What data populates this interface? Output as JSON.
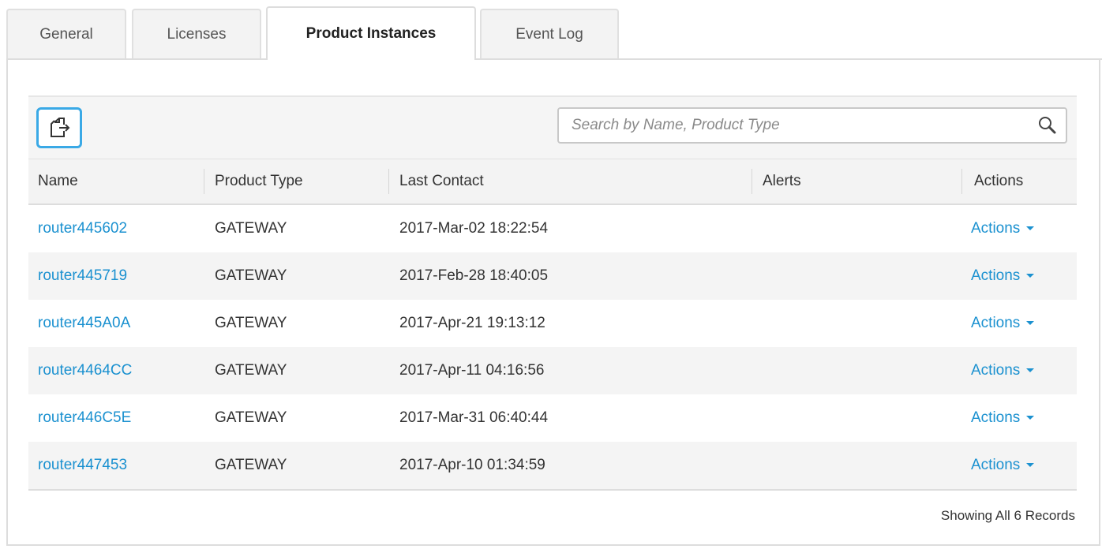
{
  "tabs": [
    {
      "label": "General",
      "active": false
    },
    {
      "label": "Licenses",
      "active": false
    },
    {
      "label": "Product Instances",
      "active": true
    },
    {
      "label": "Event Log",
      "active": false
    }
  ],
  "toolbar": {
    "export_icon": "export-icon",
    "search_placeholder": "Search by Name, Product Type",
    "search_value": "",
    "search_icon": "search-icon"
  },
  "table": {
    "columns": [
      "Name",
      "Product Type",
      "Last Contact",
      "Alerts",
      "Actions"
    ],
    "rows": [
      {
        "name": "router445602",
        "product_type": "GATEWAY",
        "last_contact": "2017-Mar-02 18:22:54",
        "alerts": "",
        "actions": "Actions"
      },
      {
        "name": "router445719",
        "product_type": "GATEWAY",
        "last_contact": "2017-Feb-28 18:40:05",
        "alerts": "",
        "actions": "Actions"
      },
      {
        "name": "router445A0A",
        "product_type": "GATEWAY",
        "last_contact": "2017-Apr-21 19:13:12",
        "alerts": "",
        "actions": "Actions"
      },
      {
        "name": "router4464CC",
        "product_type": "GATEWAY",
        "last_contact": "2017-Apr-11 04:16:56",
        "alerts": "",
        "actions": "Actions"
      },
      {
        "name": "router446C5E",
        "product_type": "GATEWAY",
        "last_contact": "2017-Mar-31 06:40:44",
        "alerts": "",
        "actions": "Actions"
      },
      {
        "name": "router447453",
        "product_type": "GATEWAY",
        "last_contact": "2017-Apr-10 01:34:59",
        "alerts": "",
        "actions": "Actions"
      }
    ]
  },
  "footer": {
    "records_text": "Showing All 6 Records"
  },
  "colors": {
    "link": "#1b91d0",
    "export_border": "#3aa9e6",
    "header_bg": "#f3f3f3",
    "stripe_bg": "#f4f4f4"
  }
}
